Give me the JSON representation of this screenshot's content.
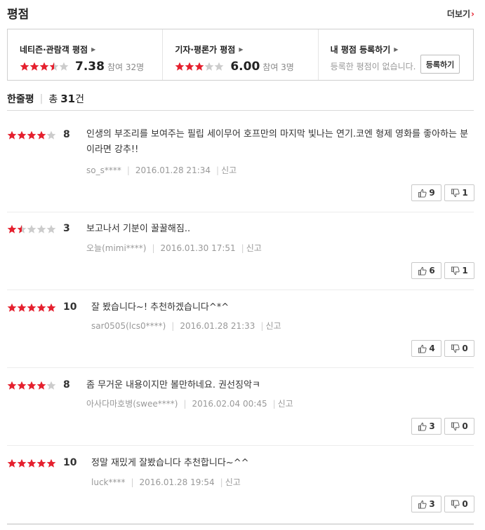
{
  "header": {
    "title": "평점",
    "more_label": "더보기",
    "more_arrow": "›"
  },
  "colors": {
    "accent": "#e5202e",
    "star_on": "#e5202e",
    "star_off": "#cccccc"
  },
  "rating_boxes": {
    "audience": {
      "label": "네티즌·관람객 평점",
      "score": "7.38",
      "participants": "참여 32명",
      "stars": 3.5
    },
    "critic": {
      "label": "기자·평론가 평점",
      "score": "6.00",
      "participants": "참여 3명",
      "stars": 3
    },
    "mine": {
      "label": "내 평점 등록하기",
      "text": "등록한 평점이 없습니다.",
      "button": "등록하기"
    }
  },
  "reviews_section": {
    "title": "한줄평",
    "total_label": "총",
    "count": "31",
    "unit": "건"
  },
  "reviews": [
    {
      "stars": 4,
      "score": "8",
      "text": "인생의 부조리를 보여주는 필립 세이무어 호프만의 마지막 빛나는 연기.코엔 형제 영화를 좋아하는 분이라면 강추!!",
      "user": "so_s****",
      "date": "2016.01.28 21:34",
      "report": "신고",
      "likes": "9",
      "dislikes": "1"
    },
    {
      "stars": 1.5,
      "score": "3",
      "text": "보고나서 기분이 꿀꿀해짐..",
      "user": "오늘(mimi****)",
      "date": "2016.01.30 17:51",
      "report": "신고",
      "likes": "6",
      "dislikes": "1"
    },
    {
      "stars": 5,
      "score": "10",
      "text": "잘 봤습니다~! 추천하겠습니다^*^",
      "user": "sar0505(lcs0****)",
      "date": "2016.01.28 21:33",
      "report": "신고",
      "likes": "4",
      "dislikes": "0"
    },
    {
      "stars": 4,
      "score": "8",
      "text": "좀 무거운 내용이지만 볼만하네요. 권선징악ㅋ",
      "user": "아사다마호병(swee****)",
      "date": "2016.02.04 00:45",
      "report": "신고",
      "likes": "3",
      "dislikes": "0"
    },
    {
      "stars": 5,
      "score": "10",
      "text": "정말 재밌게 잘봤습니다 추천합니다~^^",
      "user": "luck****",
      "date": "2016.01.28 19:54",
      "report": "신고",
      "likes": "3",
      "dislikes": "0"
    }
  ]
}
